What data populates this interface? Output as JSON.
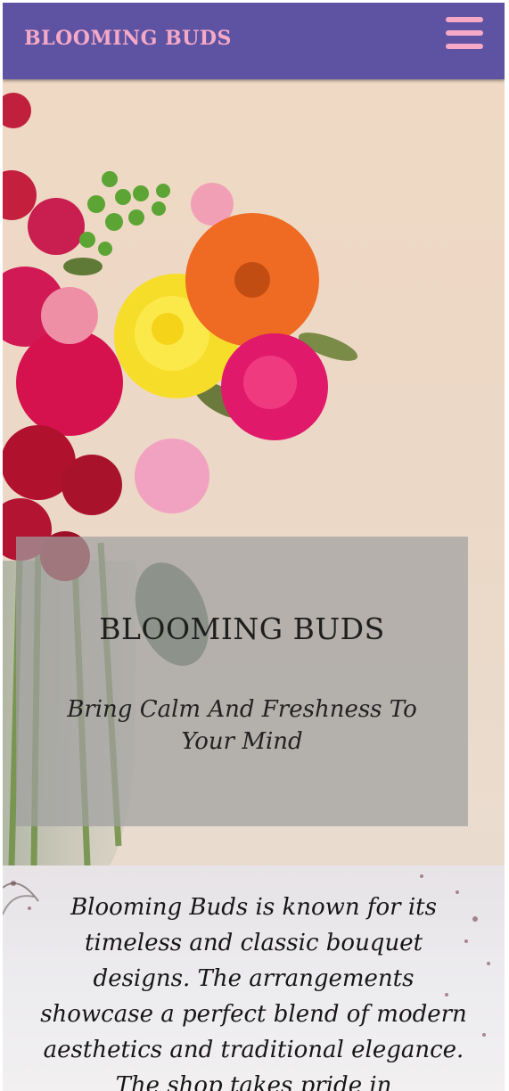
{
  "navbar": {
    "brand": "BLOOMING BUDS",
    "menu_icon": "hamburger-menu-icon",
    "background_color": "#5e53a3",
    "brand_color": "#f5a9c6"
  },
  "hero": {
    "image": "flower-bouquet-in-glass-vase",
    "title": "BLOOMING BUDS",
    "subtitle": "Bring Calm And Freshness To Your Mind"
  },
  "about": {
    "text": "Blooming Buds is known for its timeless and classic bouquet designs. The arrangements showcase a perfect blend of modern aesthetics and traditional elegance. The shop takes pride in"
  }
}
